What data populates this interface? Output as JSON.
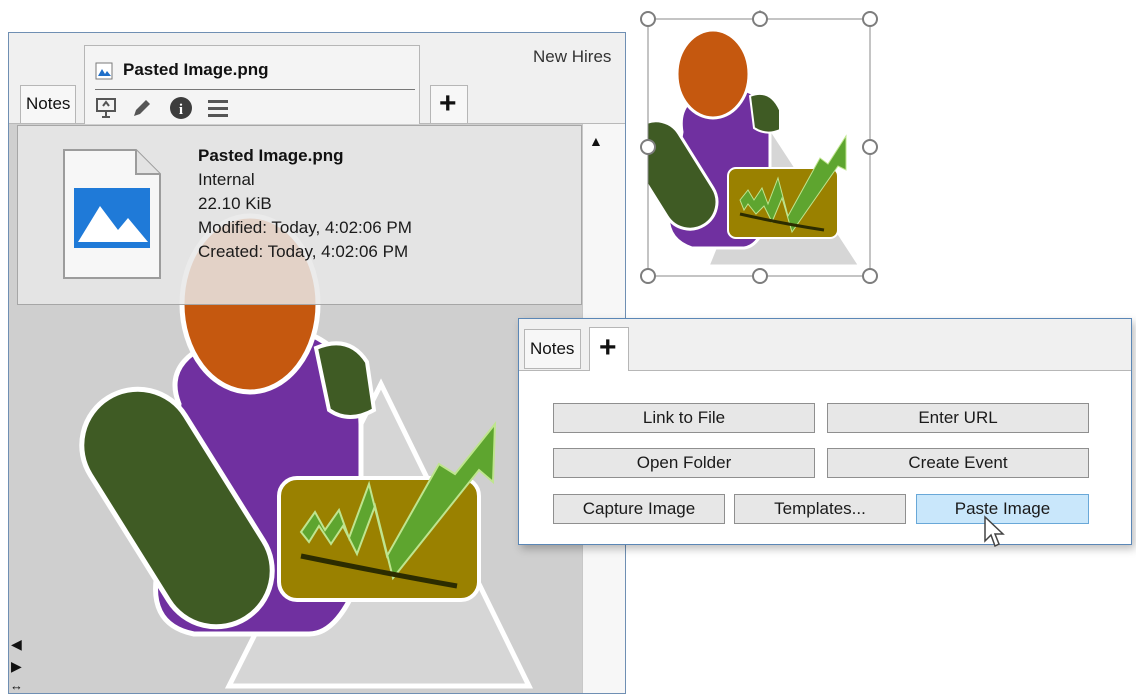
{
  "main_window": {
    "tabs": {
      "notes_label": "Notes",
      "file_tab_title": "Pasted Image.png",
      "plus_label": "+",
      "right_label": "New Hires"
    },
    "tab_tools": [
      "presentation-icon",
      "pencil-icon",
      "info-icon",
      "menu-icon"
    ],
    "file_info": {
      "name": "Pasted Image.png",
      "location": "Internal",
      "size": "22.10 KiB",
      "modified": "Modified: Today, 4:02:06 PM",
      "created": "Created: Today, 4:02:06 PM"
    }
  },
  "dialog": {
    "tabs": {
      "notes_label": "Notes",
      "plus_label": "+"
    },
    "buttons": {
      "link_to_file": "Link to File",
      "enter_url": "Enter URL",
      "open_folder": "Open Folder",
      "create_event": "Create Event",
      "capture_image": "Capture Image",
      "templates": "Templates...",
      "paste_image": "Paste Image"
    }
  },
  "colors": {
    "head": "#c5580f",
    "body": "#7030a0",
    "arm": "#3f5b24",
    "card": "#9a8100",
    "arrow": "#5ea52f",
    "triangle": "#d6d6d6",
    "active_button": "#c9e7fb"
  }
}
